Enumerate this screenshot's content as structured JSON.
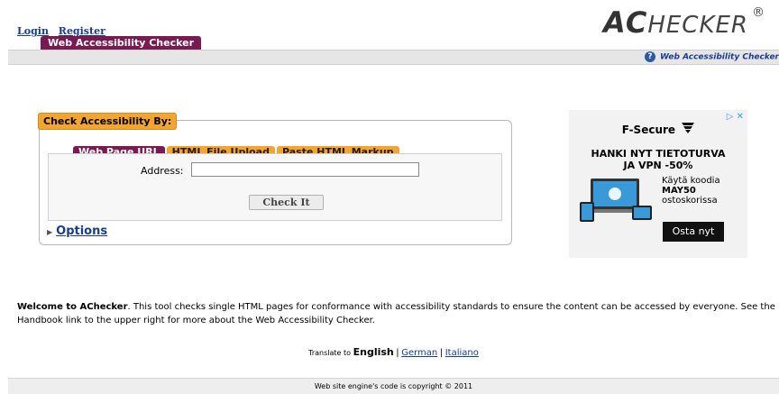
{
  "header": {
    "login_label": "Login",
    "register_label": "Register",
    "main_tab_label": "Web Accessibility Checker",
    "logo_first": "AC",
    "logo_rest": "HECKER",
    "logo_reg": "®"
  },
  "subbar": {
    "handbook_label": "Web Accessibility Checker"
  },
  "checker": {
    "legend": "Check Accessibility By:",
    "tabs": [
      {
        "label": "Web Page URL",
        "active": true
      },
      {
        "label": "HTML File Upload",
        "active": false
      },
      {
        "label": "Paste HTML Markup",
        "active": false
      }
    ],
    "address_label": "Address:",
    "address_value": "",
    "check_button": "Check It",
    "options_label": "Options"
  },
  "ad": {
    "brand": "F-Secure",
    "headline_line1": "HANKI NYT TIETOTURVA",
    "headline_line2": "JA VPN -50%",
    "promo_line1": "Käytä koodia",
    "promo_code": "MAY50",
    "promo_line3": "ostoskorissa",
    "cta": "Osta nyt",
    "close_glyph": "▷ ✕"
  },
  "welcome": {
    "bold": "Welcome to AChecker",
    "text": ". This tool checks single HTML pages for conformance with accessibility standards to ensure the content can be accessed by everyone. See the Handbook link to the upper right for more about the Web Accessibility Checker."
  },
  "translate": {
    "prefix": "Translate to",
    "current": "English",
    "sep": "|",
    "other1": "German",
    "other2": "Italiano"
  },
  "footer": {
    "text": "Web site engine's code is copyright © 2011"
  },
  "colors": {
    "tab_active": "#7a1a52",
    "tab_inactive": "#f2a531",
    "link": "#1a3c8f"
  }
}
